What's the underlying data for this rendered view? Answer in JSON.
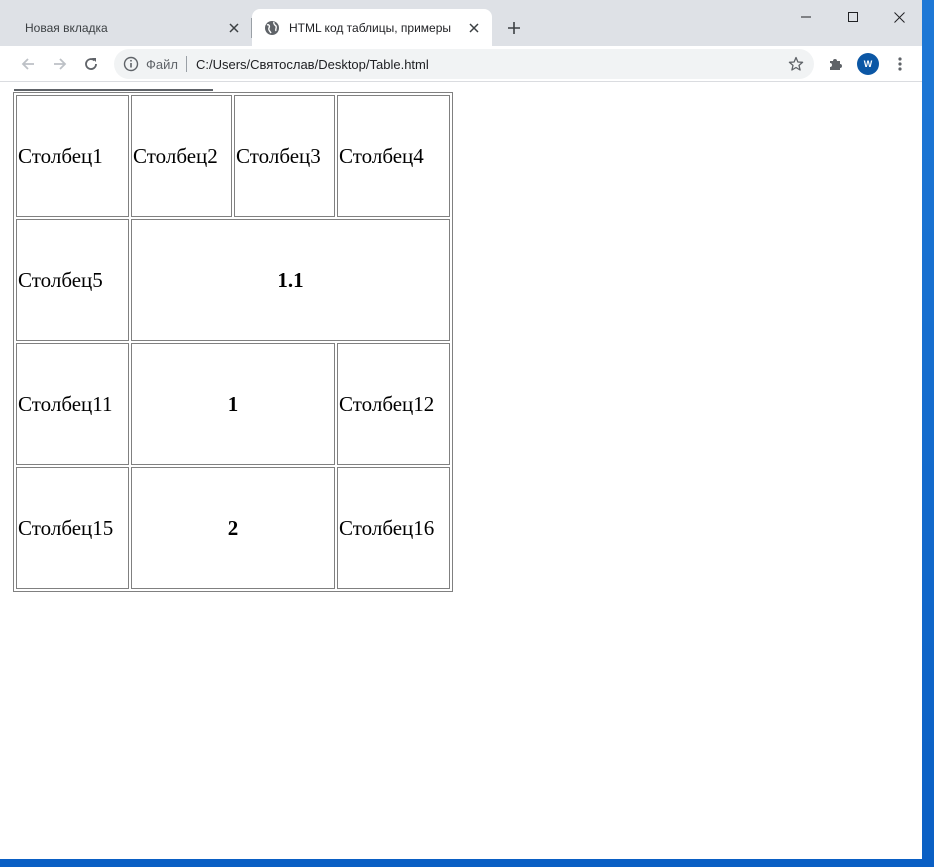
{
  "browser": {
    "tabs": [
      {
        "label": "Новая вкладка",
        "active": false
      },
      {
        "label": "HTML код таблицы, примеры",
        "active": true
      }
    ],
    "address": {
      "scheme_label": "Файл",
      "url": "C:/Users/Святослав/Desktop/Table.html"
    },
    "profile_initial": "W",
    "icons": {
      "back": "arrow-left-icon",
      "forward": "arrow-right-icon",
      "reload": "reload-icon",
      "info": "info-icon",
      "bookmark": "star-icon",
      "extensions": "puzzle-icon",
      "menu": "kebab-menu-icon",
      "tab_favicon": "globe-icon"
    },
    "accent_color": "#0b57a5"
  },
  "table": {
    "rows": [
      {
        "cells": [
          {
            "text": "Столбец1"
          },
          {
            "text": "Столбец2"
          },
          {
            "text": "Столбец3"
          },
          {
            "text": "Столбец4"
          }
        ]
      },
      {
        "cells": [
          {
            "text": "Столбец5"
          },
          {
            "text": "1.1",
            "colspan": 3,
            "bold": true
          }
        ]
      },
      {
        "cells": [
          {
            "text": "Столбец11"
          },
          {
            "text": "1",
            "colspan": 2,
            "bold": true
          },
          {
            "text": "Столбец12"
          }
        ]
      },
      {
        "cells": [
          {
            "text": "Столбец15"
          },
          {
            "text": "2",
            "colspan": 2,
            "bold": true
          },
          {
            "text": "Столбец16"
          }
        ]
      }
    ]
  }
}
